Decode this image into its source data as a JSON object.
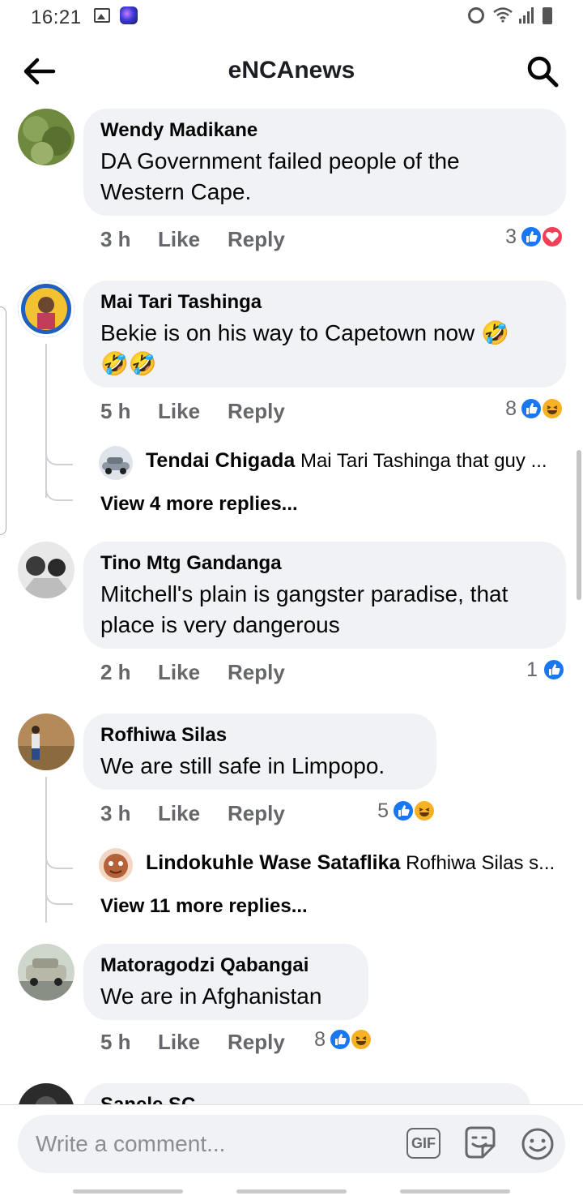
{
  "status_bar": {
    "time": "16:21",
    "icons": [
      "gallery-icon",
      "app-icon",
      "alarm-icon",
      "wifi-icon",
      "signal-icon",
      "battery-icon"
    ]
  },
  "header": {
    "title": "eNCAnews",
    "back_icon": "arrow-left-icon",
    "search_icon": "search-icon"
  },
  "labels": {
    "like": "Like",
    "reply": "Reply"
  },
  "comments": [
    {
      "author": "Wendy Madikane",
      "text": [
        "DA Government failed people of the",
        "Western Cape."
      ],
      "time": "3 h",
      "reaction_count": "3",
      "reactions": [
        "like",
        "love"
      ]
    },
    {
      "author": "Mai Tari Tashinga",
      "text": [
        "Bekie is on his way to Capetown now 🤣",
        "🤣🤣"
      ],
      "time": "5 h",
      "reaction_count": "8",
      "reactions": [
        "like",
        "haha"
      ],
      "reply_preview": {
        "name": "Tendai Chigada",
        "text": "Mai Tari Tashinga that guy ..."
      },
      "view_more": "View 4 more replies..."
    },
    {
      "author": "Tino Mtg Gandanga",
      "text": [
        "Mitchell's plain is gangster paradise, that",
        "place is very dangerous"
      ],
      "time": "2 h",
      "reaction_count": "1",
      "reactions": [
        "like"
      ]
    },
    {
      "author": "Rofhiwa Silas",
      "text": [
        "We are still safe in Limpopo."
      ],
      "time": "3 h",
      "reaction_count": "5",
      "reactions": [
        "like",
        "haha"
      ],
      "reply_preview": {
        "name": "Lindokuhle Wase Sataflika",
        "text": "Rofhiwa Silas  s..."
      },
      "view_more": "View 11 more replies..."
    },
    {
      "author": "Matoragodzi Qabangai",
      "text": [
        "We are in Afghanistan"
      ],
      "time": "5 h",
      "reaction_count": "8",
      "reactions": [
        "like",
        "haha"
      ]
    },
    {
      "author": "Sanele SC",
      "text": [],
      "time": "",
      "reaction_count": "",
      "reactions": []
    }
  ],
  "composer": {
    "placeholder": "Write a comment...",
    "gif_label": "GIF",
    "icons": [
      "gif-icon",
      "sticker-icon",
      "emoji-icon"
    ]
  },
  "colors": {
    "accent_blue": "#1877f2",
    "bubble_bg": "#f0f2f5",
    "muted_text": "#65676b",
    "love_red": "#f33e58",
    "haha_yellow": "#f7b125"
  }
}
